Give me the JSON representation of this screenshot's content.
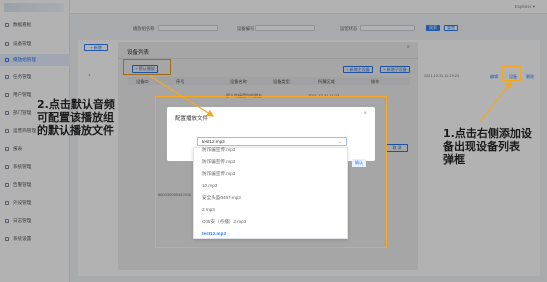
{
  "header": {
    "user": "Explorer ▾"
  },
  "sidebar": {
    "items": [
      {
        "label": "数据看板"
      },
      {
        "label": "设备管理"
      },
      {
        "label": "播放组管理"
      },
      {
        "label": "任务管理"
      },
      {
        "label": "用户管理"
      },
      {
        "label": "部门管理"
      },
      {
        "label": "运营商管理"
      },
      {
        "label": "报表"
      },
      {
        "label": "系统管理"
      },
      {
        "label": "告警管理"
      },
      {
        "label": "外设管理"
      },
      {
        "label": "日志管理"
      },
      {
        "label": "系统设置"
      }
    ]
  },
  "filters": {
    "name_label": "播放组名称",
    "device_label": "设备编号",
    "status_label": "运营状态",
    "search_label": "搜索",
    "reset_label": "重置"
  },
  "page": {
    "add_btn": "+ 新增",
    "row_index": "1",
    "row_time": "2021-12-31 11:19:24",
    "row_edit": "编辑",
    "row_device": "设备",
    "row_delete": "删除"
  },
  "device_dialog": {
    "title": "设备列表",
    "default_btn": "+ 默认播放",
    "add_device_btn": "+ 新增主设备",
    "add_sub_btn": "+ 新增子设备",
    "columns": [
      "设备ID",
      "序号",
      "设备名称",
      "设备类型",
      "所属区域",
      "操作"
    ],
    "row_text": "那么你接受你的朋友",
    "row_time": "2021-12-31 11:23",
    "confirm_btn": "确认",
    "cancel_btn": "取 消",
    "bottom_id": "860430050442016"
  },
  "audio_dialog": {
    "title": "配置播放文件",
    "selected": "test12.mp3",
    "options": [
      "防诈骗宣传.mp3",
      "防诈骗宣传.mp3",
      "防诈骗宣传.mp3",
      "10.mp3",
      "安全头盔0457.mp3",
      "2.mp3",
      "C05安（点播）2.mp3",
      "test12.mp3"
    ],
    "ok_btn": "确认"
  },
  "annotations": {
    "left": [
      "2.点击默认音频",
      "可配置该播放组",
      "的默认播放文件"
    ],
    "right": [
      "1.点击右侧添加设",
      "备出现设备列表",
      "弹框"
    ]
  },
  "colors": {
    "accent": "#2f7ef6",
    "highlight": "#f5a623"
  }
}
